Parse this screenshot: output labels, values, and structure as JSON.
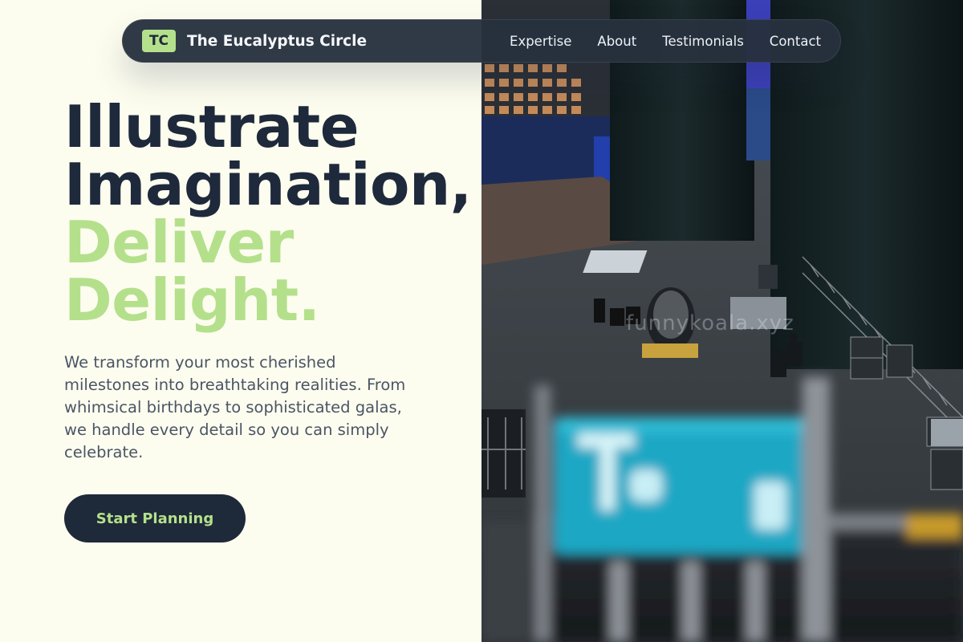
{
  "nav": {
    "logo_initials": "TC",
    "brand_name": "The Eucalyptus Circle",
    "links": [
      {
        "label": "Expertise"
      },
      {
        "label": "About"
      },
      {
        "label": "Testimonials"
      },
      {
        "label": "Contact"
      }
    ]
  },
  "hero": {
    "headline_line1": "Illustrate",
    "headline_line2": "Imagination,",
    "headline_line3": "Deliver",
    "headline_line4": "Delight.",
    "description": "We transform your most cherished milestones into breathtaking realities. From whimsical birthdays to sophisticated galas, we handle every detail so you can simply celebrate.",
    "cta_label": "Start Planning"
  },
  "photo": {
    "watermark": "funnykoala.xyz"
  },
  "colors": {
    "background": "#fdfdef",
    "dark": "#1e293b",
    "accent_green": "#b4e08c",
    "nav_bg": "#28313e"
  }
}
